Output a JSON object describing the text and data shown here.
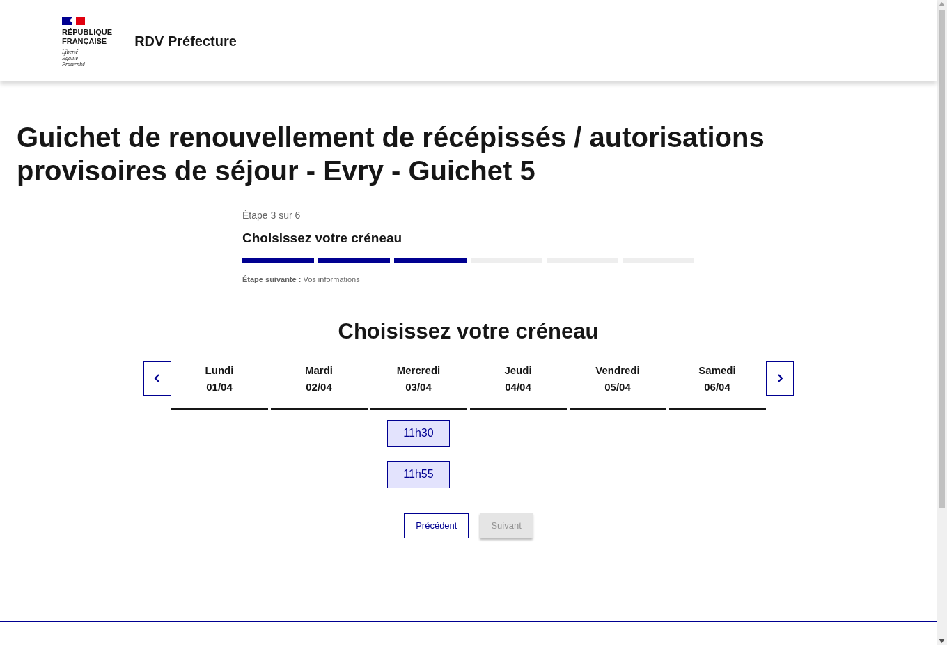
{
  "header": {
    "logo_lines": [
      "RÉPUBLIQUE",
      "FRANÇAISE"
    ],
    "motto": [
      "Liberté",
      "Égalité",
      "Fraternité"
    ],
    "service_name": "RDV Préfecture"
  },
  "page_title": "Guichet de renouvellement de récépissés / autorisations provisoires de séjour - Evry - Guichet 5",
  "stepper": {
    "step_label": "Étape 3 sur 6",
    "current_title": "Choisissez votre créneau",
    "steps": [
      {
        "done": true
      },
      {
        "done": true
      },
      {
        "done": true
      },
      {
        "done": false
      },
      {
        "done": false
      },
      {
        "done": false
      }
    ],
    "next_label": "Étape suivante :",
    "next_value": "Vos informations"
  },
  "calendar": {
    "title": "Choisissez votre créneau",
    "days": [
      {
        "name": "Lundi",
        "date": "01/04"
      },
      {
        "name": "Mardi",
        "date": "02/04"
      },
      {
        "name": "Mercredi",
        "date": "03/04",
        "slots": [
          {
            "time": "11h30",
            "selected": false
          },
          {
            "time": "11h55",
            "selected": false
          }
        ]
      },
      {
        "name": "Jeudi",
        "date": "04/04"
      },
      {
        "name": "Vendredi",
        "date": "05/04"
      },
      {
        "name": "Samedi",
        "date": "06/04"
      }
    ]
  },
  "buttons": [
    {
      "label": "Précédent",
      "kind": "secondary",
      "disabled": false
    },
    {
      "label": "Suivant",
      "kind": "primary",
      "disabled": true
    }
  ]
}
